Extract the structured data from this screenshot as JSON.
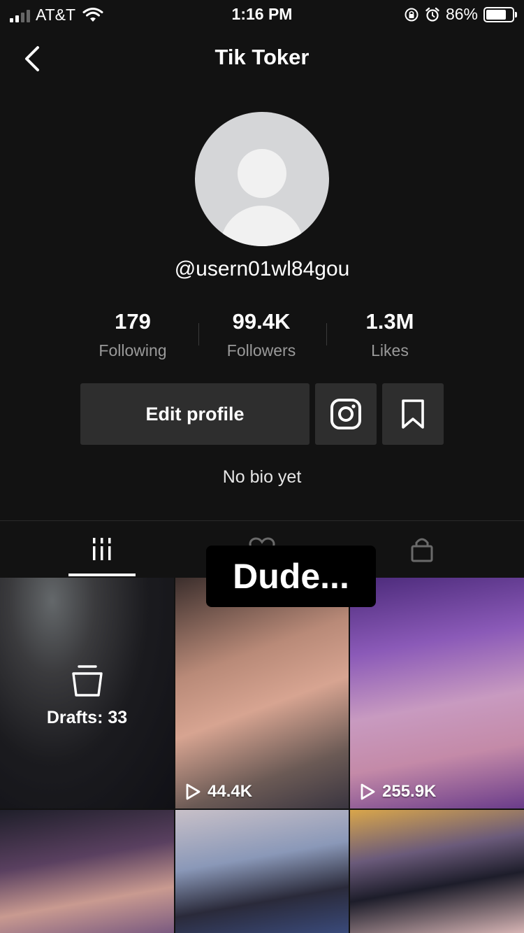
{
  "status_bar": {
    "carrier": "AT&T",
    "time": "1:16 PM",
    "battery_percent": "86%",
    "battery_level": 0.86
  },
  "nav": {
    "title": "Tik Toker",
    "back_icon": "chevron-left-icon"
  },
  "profile": {
    "username": "@usern01wl84gou",
    "bio": "No bio yet",
    "stats": [
      {
        "value": "179",
        "label": "Following"
      },
      {
        "value": "99.4K",
        "label": "Followers"
      },
      {
        "value": "1.3M",
        "label": "Likes"
      }
    ],
    "edit_button": "Edit profile",
    "instagram_icon": "instagram-icon",
    "bookmark_icon": "bookmark-icon"
  },
  "tabs": [
    {
      "icon": "grid-icon",
      "active": true
    },
    {
      "icon": "heart-icon",
      "active": false
    },
    {
      "icon": "lock-icon",
      "active": false
    }
  ],
  "overlay_caption": "Dude...",
  "videos": [
    {
      "type": "drafts",
      "label": "Drafts: 33"
    },
    {
      "type": "video",
      "views": "44.4K"
    },
    {
      "type": "video",
      "views": "255.9K"
    },
    {
      "type": "video",
      "views": ""
    },
    {
      "type": "video",
      "views": ""
    },
    {
      "type": "video",
      "views": ""
    }
  ],
  "colors": {
    "background": "#121212",
    "button_bg": "#2e2e2e",
    "muted_text": "#9a9a9a"
  }
}
